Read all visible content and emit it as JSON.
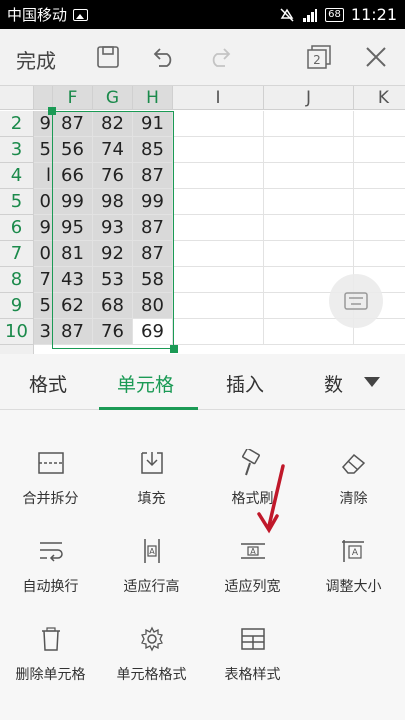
{
  "status_bar": {
    "carrier": "中国移动",
    "battery": "68",
    "time": "11:21"
  },
  "toolbar": {
    "done_label": "完成",
    "window_count": "2"
  },
  "sheet": {
    "columns": [
      "F",
      "G",
      "H",
      "I",
      "J",
      "K"
    ],
    "rows": [
      {
        "num": "2",
        "cut": "9",
        "F": "87",
        "G": "82",
        "H": "91"
      },
      {
        "num": "3",
        "cut": "5",
        "F": "56",
        "G": "74",
        "H": "85"
      },
      {
        "num": "4",
        "cut": "l",
        "F": "66",
        "G": "76",
        "H": "87"
      },
      {
        "num": "5",
        "cut": "0",
        "F": "99",
        "G": "98",
        "H": "99"
      },
      {
        "num": "6",
        "cut": "9",
        "F": "95",
        "G": "93",
        "H": "87"
      },
      {
        "num": "7",
        "cut": "0",
        "F": "81",
        "G": "92",
        "H": "87"
      },
      {
        "num": "8",
        "cut": "7",
        "F": "43",
        "G": "53",
        "H": "58"
      },
      {
        "num": "9",
        "cut": "5",
        "F": "62",
        "G": "68",
        "H": "80"
      },
      {
        "num": "10",
        "cut": "3",
        "F": "87",
        "G": "76",
        "H": "69"
      }
    ]
  },
  "tabs": [
    "格式",
    "单元格",
    "插入",
    "数"
  ],
  "active_tab": "单元格",
  "tools": [
    {
      "label": "合并拆分",
      "icon": "merge-split-icon"
    },
    {
      "label": "填充",
      "icon": "fill-icon"
    },
    {
      "label": "格式刷",
      "icon": "format-painter-icon"
    },
    {
      "label": "清除",
      "icon": "eraser-icon"
    },
    {
      "label": "自动换行",
      "icon": "wrap-text-icon"
    },
    {
      "label": "适应行高",
      "icon": "fit-row-height-icon"
    },
    {
      "label": "适应列宽",
      "icon": "fit-column-width-icon"
    },
    {
      "label": "调整大小",
      "icon": "resize-icon"
    },
    {
      "label": "删除单元格",
      "icon": "delete-cell-icon"
    },
    {
      "label": "单元格格式",
      "icon": "cell-format-icon"
    },
    {
      "label": "表格样式",
      "icon": "table-style-icon"
    }
  ],
  "colors": {
    "accent": "#1b9a55",
    "annotation_arrow": "#c0182a"
  }
}
